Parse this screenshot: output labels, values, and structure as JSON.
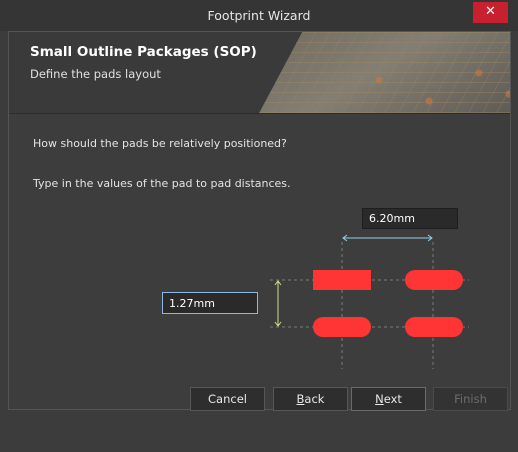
{
  "window": {
    "title": "Footprint Wizard",
    "close_glyph": "✕"
  },
  "banner": {
    "title": "Small Outline Packages (SOP)",
    "subtitle": "Define the pads layout"
  },
  "body": {
    "question": "How should the pads be relatively positioned?",
    "instruction": "Type in the values of the pad to pad distances."
  },
  "inputs": {
    "horizontal_distance": "6.20mm",
    "vertical_distance": "1.27mm"
  },
  "buttons": {
    "cancel": "Cancel",
    "back_first": "B",
    "back_rest": "ack",
    "next_first": "N",
    "next_rest": "ext",
    "finish": "Finish"
  },
  "colors": {
    "pad": "#ff3535",
    "horizontal_arrow": "#8fd0e8",
    "vertical_arrow": "#d8d890",
    "focused_border": "#8fb7e0"
  },
  "icons": {
    "close": "close-icon"
  }
}
